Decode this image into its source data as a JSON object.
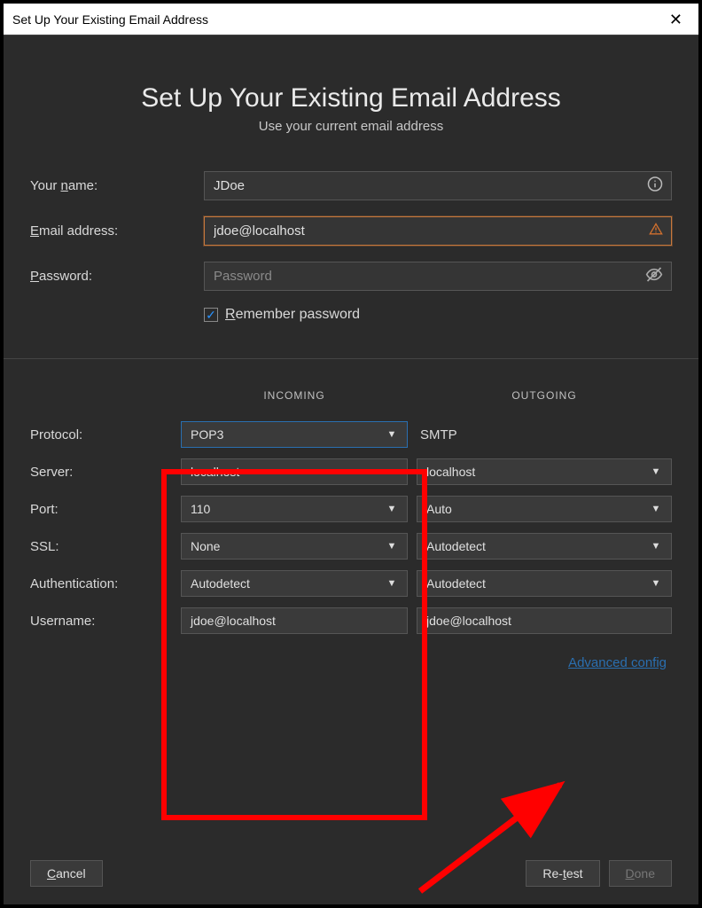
{
  "window": {
    "title": "Set Up Your Existing Email Address"
  },
  "header": {
    "title": "Set Up Your Existing Email Address",
    "subtitle": "Use your current email address"
  },
  "fields": {
    "name_label": "Your name:",
    "name_value": "JDoe",
    "email_label": "Email address:",
    "email_value": "jdoe@localhost",
    "password_label": "Password:",
    "password_placeholder": "Password",
    "remember_label_pre": "R",
    "remember_label_post": "emember password"
  },
  "server": {
    "col_incoming": "INCOMING",
    "col_outgoing": "OUTGOING",
    "rows": {
      "protocol_label": "Protocol:",
      "protocol_in": "POP3",
      "protocol_out": "SMTP",
      "server_label": "Server:",
      "server_in": "localhost",
      "server_out": "localhost",
      "port_label": "Port:",
      "port_in": "110",
      "port_out": "Auto",
      "ssl_label": "SSL:",
      "ssl_in": "None",
      "ssl_out": "Autodetect",
      "auth_label": "Authentication:",
      "auth_in": "Autodetect",
      "auth_out": "Autodetect",
      "user_label": "Username:",
      "user_in": "jdoe@localhost",
      "user_out": "jdoe@localhost"
    },
    "adv_link": "Advanced config"
  },
  "footer": {
    "cancel": "Cancel",
    "retest": "Re-test",
    "done": "Done"
  }
}
